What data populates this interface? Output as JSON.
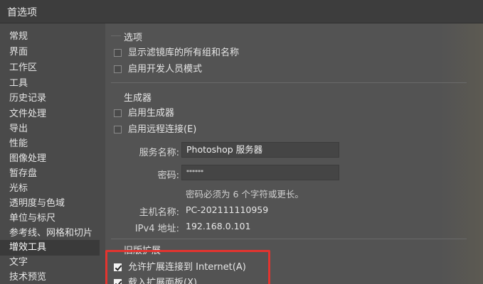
{
  "window": {
    "title": "首选项"
  },
  "sidebar": {
    "items": [
      {
        "label": "常规"
      },
      {
        "label": "界面"
      },
      {
        "label": "工作区"
      },
      {
        "label": "工具"
      },
      {
        "label": "历史记录"
      },
      {
        "label": "文件处理"
      },
      {
        "label": "导出"
      },
      {
        "label": "性能"
      },
      {
        "label": "图像处理"
      },
      {
        "label": "暂存盘"
      },
      {
        "label": "光标"
      },
      {
        "label": "透明度与色域"
      },
      {
        "label": "单位与标尺"
      },
      {
        "label": "参考线、网格和切片"
      },
      {
        "label": "增效工具"
      },
      {
        "label": "文字"
      },
      {
        "label": "技术预览"
      }
    ],
    "active_label": "增效工具"
  },
  "options": {
    "title": "选项",
    "show_filter_gallery": {
      "label": "显示滤镜库的所有组和名称",
      "checked": false
    },
    "developer_mode": {
      "label": "启用开发人员模式",
      "checked": false
    }
  },
  "generator": {
    "title": "生成器",
    "enable_generator": {
      "label": "启用生成器",
      "checked": false
    },
    "enable_remote": {
      "label": "启用远程连接(E)",
      "checked": false
    },
    "service_name_label": "服务名称:",
    "service_name_value": "Photoshop 服务器",
    "password_label": "密码:",
    "password_value": "******",
    "password_hint": "密码必须为 6 个字符或更长。",
    "hostname_label": "主机名称:",
    "hostname_value": "PC-202111110959",
    "ipv4_label": "IPv4 地址:",
    "ipv4_value": "192.168.0.101"
  },
  "legacy_extensions": {
    "title": "旧版扩展",
    "allow_internet": {
      "label": "允许扩展连接到 Internet(A)",
      "checked": true
    },
    "load_panels": {
      "label": "载入扩展面板(X)",
      "checked": true
    }
  },
  "colors": {
    "highlight": "#e3342f",
    "background": "#535353",
    "sidebar": "#4a4a4a",
    "active_item": "#3a3a3a"
  }
}
